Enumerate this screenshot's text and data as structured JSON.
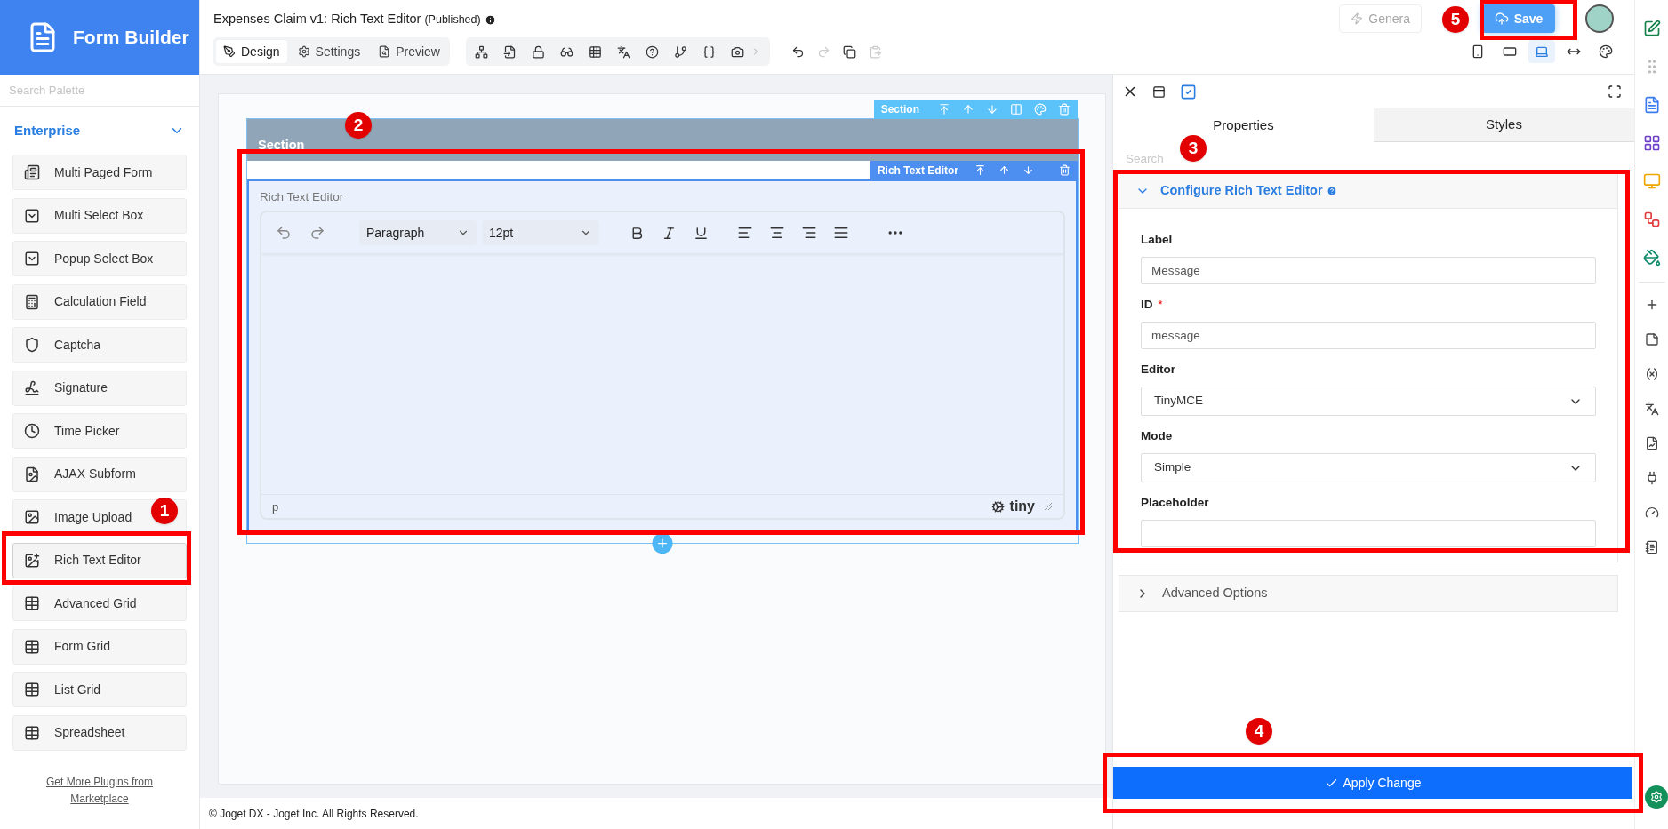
{
  "brand": {
    "title": "Form Builder"
  },
  "palette": {
    "search_placeholder": "Search Palette",
    "group": "Enterprise",
    "expanded": true,
    "items": [
      {
        "label": "Multi Paged Form",
        "selected": false
      },
      {
        "label": "Multi Select Box",
        "selected": false
      },
      {
        "label": "Popup Select Box",
        "selected": false
      },
      {
        "label": "Calculation Field",
        "selected": false
      },
      {
        "label": "Captcha",
        "selected": false
      },
      {
        "label": "Signature",
        "selected": false
      },
      {
        "label": "Time Picker",
        "selected": false
      },
      {
        "label": "AJAX Subform",
        "selected": false
      },
      {
        "label": "Image Upload",
        "selected": false
      },
      {
        "label": "Rich Text Editor",
        "selected": true
      },
      {
        "label": "Advanced Grid",
        "selected": false
      },
      {
        "label": "Form Grid",
        "selected": false
      },
      {
        "label": "List Grid",
        "selected": false
      },
      {
        "label": "Spreadsheet",
        "selected": false
      }
    ],
    "link": "Get More Plugins from Marketplace"
  },
  "header": {
    "form_title": "Expenses Claim v1: Rich Text Editor",
    "status": "(Published)",
    "tabs": [
      {
        "label": "Design",
        "selected": true
      },
      {
        "label": "Settings",
        "selected": false
      },
      {
        "label": "Preview",
        "selected": false
      }
    ],
    "generate": "Genera",
    "save": "Save",
    "devices": [
      {
        "selected": false
      },
      {
        "selected": false
      },
      {
        "selected": true
      },
      {
        "selected": false
      },
      {
        "selected": false
      }
    ]
  },
  "canvas": {
    "section_title": "Section",
    "section_toolbar": "Section",
    "element_toolbar": "Rich Text Editor",
    "field_label": "Rich Text Editor",
    "editor": {
      "block_format": "Paragraph",
      "font_size": "12pt",
      "path": "p",
      "brand": "tiny"
    }
  },
  "panel": {
    "tabs": [
      {
        "label": "Properties",
        "selected": true
      },
      {
        "label": "Styles",
        "selected": false
      }
    ],
    "search_placeholder": "Search",
    "group": {
      "title": "Configure Rich Text Editor",
      "expanded": true,
      "fields": [
        {
          "label": "Label",
          "kind": "text",
          "value": "Message"
        },
        {
          "label": "ID",
          "kind": "text",
          "required_mark": "*",
          "value": "message"
        },
        {
          "label": "Editor",
          "kind": "select",
          "value": "TinyMCE"
        },
        {
          "label": "Mode",
          "kind": "select",
          "value": "Simple"
        },
        {
          "label": "Placeholder",
          "kind": "text"
        }
      ]
    },
    "advanced": {
      "title": "Advanced Options",
      "expanded": false
    },
    "apply": "Apply Change"
  },
  "footer": "© Joget DX - Joget Inc. All Rights Reserved.",
  "annotations": [
    "1",
    "2",
    "3",
    "4",
    "5"
  ]
}
